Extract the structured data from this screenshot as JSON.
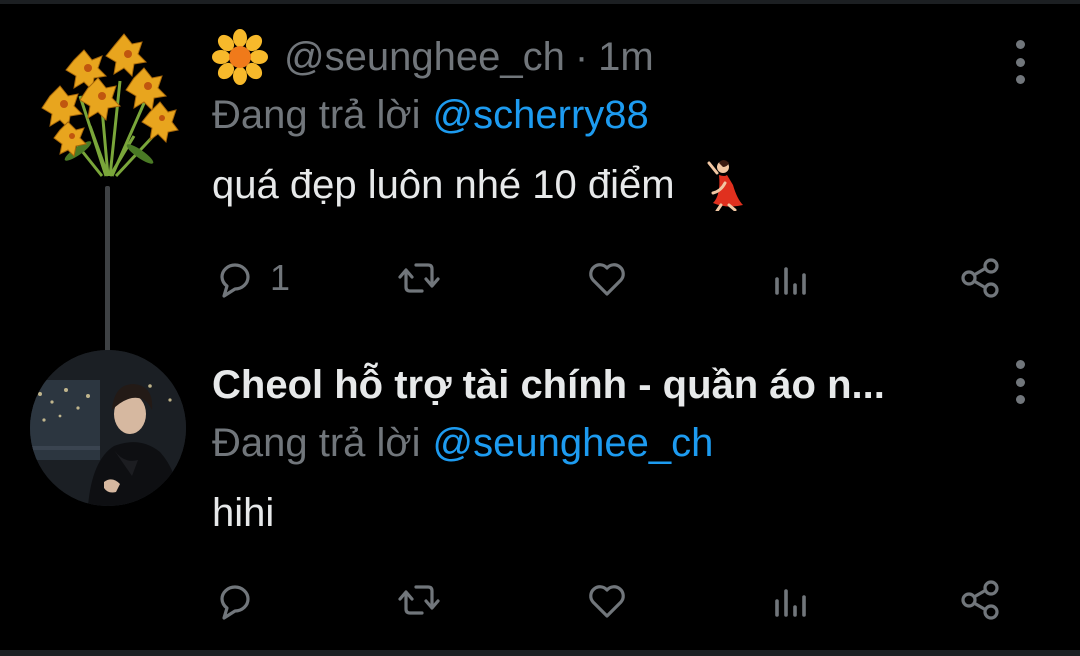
{
  "tweets": [
    {
      "handle": "@seunghee_ch",
      "separator": "·",
      "time": "1m",
      "reply_prefix": "Đang trả lời",
      "reply_to": "@scherry88",
      "body": "quá đẹp luôn nhé 10 điểm",
      "badge_icon": "blossom-emoji-icon",
      "body_icon": "dancer-emoji-icon",
      "actions": {
        "reply_count": "1",
        "retweet_count": "",
        "like_count": ""
      }
    },
    {
      "display_name": "Cheol hỗ trợ tài chính - quần áo n...",
      "reply_prefix": "Đang trả lời",
      "reply_to": "@seunghee_ch",
      "body": "hihi",
      "actions": {
        "reply_count": "",
        "retweet_count": "",
        "like_count": ""
      }
    }
  ],
  "colors": {
    "background": "#000000",
    "primary_text": "#e7e9ea",
    "secondary_text": "#71767b",
    "link": "#1d9bf0",
    "thread_line": "#3e4144"
  }
}
